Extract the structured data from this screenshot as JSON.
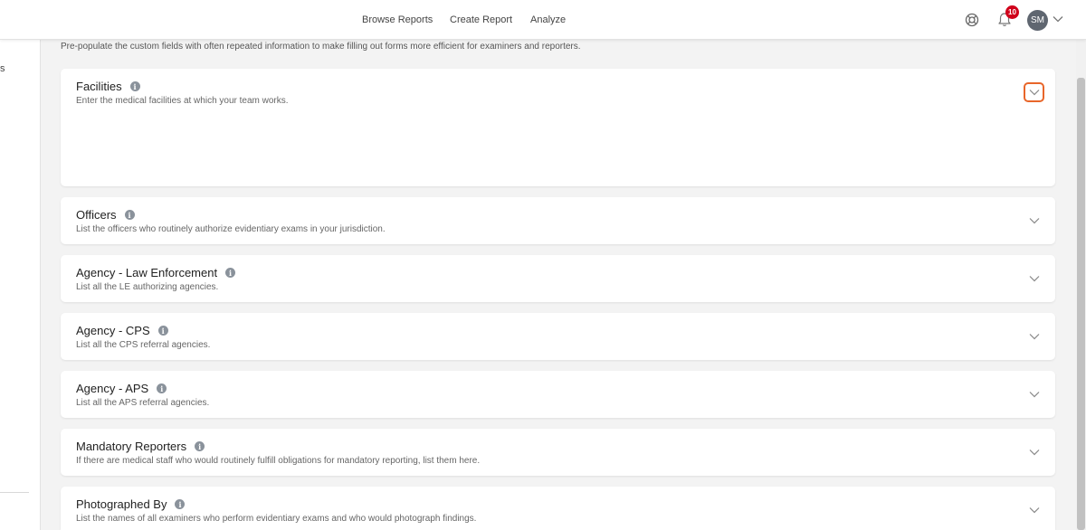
{
  "nav": {
    "browse_reports": "Browse Reports",
    "create_report": "Create Report",
    "analyze": "Analyze"
  },
  "header": {
    "notification_count": "10",
    "avatar_initials": "SM"
  },
  "sidebar": {
    "partial_text": "s"
  },
  "intro_text": "Pre-populate the custom fields with often repeated information to make filling out forms more efficient for examiners and reporters.",
  "sections": [
    {
      "title": "Facilities",
      "description": "Enter the medical facilities at which your team works."
    },
    {
      "title": "Officers",
      "description": "List the officers who routinely authorize evidentiary exams in your jurisdiction."
    },
    {
      "title": "Agency - Law Enforcement",
      "description": "List all the LE authorizing agencies."
    },
    {
      "title": "Agency - CPS",
      "description": "List all the CPS referral agencies."
    },
    {
      "title": "Agency - APS",
      "description": "List all the APS referral agencies."
    },
    {
      "title": "Mandatory Reporters",
      "description": "If there are medical staff who would routinely fulfill obligations for mandatory reporting, list them here."
    },
    {
      "title": "Photographed By",
      "description": "List the names of all examiners who perform evidentiary exams and who would photograph findings."
    }
  ],
  "colors": {
    "focus_ring": "#e8662a",
    "badge": "#d0021b",
    "avatar": "#5f6670"
  }
}
